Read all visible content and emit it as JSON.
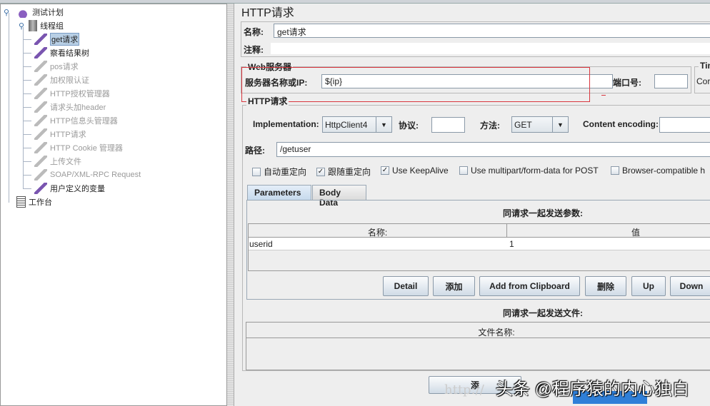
{
  "tree": {
    "root": "测试计划",
    "thread_group": "线程组",
    "items": [
      {
        "label": "get请求",
        "state": "selected"
      },
      {
        "label": "察看结果树",
        "state": "enabled"
      },
      {
        "label": "pos请求",
        "state": "disabled"
      },
      {
        "label": "加权限认证",
        "state": "disabled"
      },
      {
        "label": "HTTP授权管理器",
        "state": "disabled"
      },
      {
        "label": "请求头加header",
        "state": "disabled"
      },
      {
        "label": "HTTP信息头管理器",
        "state": "disabled"
      },
      {
        "label": "HTTP请求",
        "state": "disabled"
      },
      {
        "label": "HTTP Cookie 管理器",
        "state": "disabled"
      },
      {
        "label": "上传文件",
        "state": "disabled"
      },
      {
        "label": "SOAP/XML-RPC Request",
        "state": "disabled"
      },
      {
        "label": "用户定义的变量",
        "state": "enabled"
      }
    ],
    "workbench": "工作台"
  },
  "panel": {
    "title": "HTTP请求",
    "name_label": "名称:",
    "name_value": "get请求",
    "comment_label": "注释:",
    "comment_value": "",
    "web_server_legend": "Web服务器",
    "server_label": "服务器名称或IP:",
    "server_value": "${ip}",
    "port_label": "端口号:",
    "port_value": "",
    "timeout_legend": "Tim",
    "timeout_connect": "Cor",
    "http_request_legend": "HTTP请求",
    "implementation_label": "Implementation:",
    "implementation_value": "HttpClient4",
    "protocol_label": "协议:",
    "protocol_value": "",
    "method_label": "方法:",
    "method_value": "GET",
    "encoding_label": "Content encoding:",
    "encoding_value": "",
    "path_label": "路径:",
    "path_value": "/getuser",
    "checkboxes": [
      {
        "label": "自动重定向",
        "checked": false
      },
      {
        "label": "跟随重定向",
        "checked": true
      },
      {
        "label": "Use KeepAlive",
        "checked": true
      },
      {
        "label": "Use multipart/form-data for POST",
        "checked": false
      },
      {
        "label": "Browser-compatible h",
        "checked": false
      }
    ],
    "tabs": [
      "Parameters",
      "Body Data"
    ],
    "params_title": "同请求一起发送参数:",
    "params_columns": [
      "名称:",
      "值"
    ],
    "params_rows": [
      [
        "userid",
        "1"
      ]
    ],
    "buttons": [
      "Detail",
      "添加",
      "Add from Clipboard",
      "删除",
      "Up",
      "Down"
    ],
    "files_title": "同请求一起发送文件:",
    "files_column": "文件名称:",
    "bottom_button": "添"
  },
  "watermark": {
    "text": "头条 @程序猿的内心独白",
    "url": "http://"
  }
}
